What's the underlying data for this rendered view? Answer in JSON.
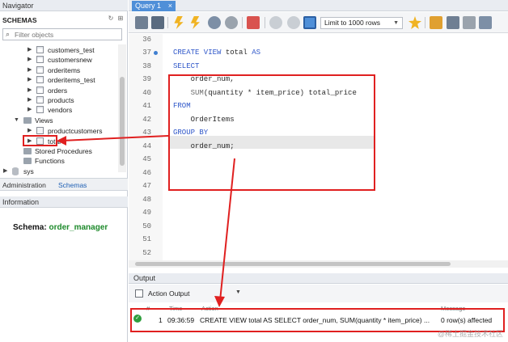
{
  "navigator": {
    "title": "Navigator",
    "schemas_title": "SCHEMAS",
    "filter_placeholder": "Filter objects",
    "tables": [
      "customers_test",
      "customersnew",
      "orderitems",
      "orderitems_test",
      "orders",
      "products",
      "vendors"
    ],
    "views_label": "Views",
    "views": [
      "productcustomers",
      "total"
    ],
    "stored_procedures_label": "Stored Procedures",
    "functions_label": "Functions",
    "sys_label": "sys",
    "tabs": [
      "Administration",
      "Schemas"
    ],
    "active_tab": "Schemas"
  },
  "information": {
    "title": "Information",
    "schema_label": "Schema:",
    "schema_value": "order_manager"
  },
  "editor": {
    "tab_title": "Query 1",
    "limit_label": "Limit to 1000 rows",
    "line_numbers": [
      "36",
      "37",
      "38",
      "39",
      "40",
      "41",
      "42",
      "43",
      "44",
      "45",
      "46",
      "47",
      "48",
      "49",
      "50",
      "51",
      "52"
    ],
    "sql": {
      "l37_kw": "CREATE VIEW",
      "l37_rest": " total ",
      "l37_kw2": "AS",
      "l38": "SELECT",
      "l39": "    order_num,",
      "l40_fn": "    SUM",
      "l40_rest": "(quantity * item_price) total_price",
      "l41": "FROM",
      "l42": "    OrderItems",
      "l43": "GROUP BY",
      "l44": "    order_num;"
    }
  },
  "output": {
    "title": "Output",
    "mode": "Action Output",
    "columns": [
      "#",
      "Time",
      "Action",
      "Message"
    ],
    "row": {
      "index": "1",
      "time": "09:36:59",
      "action": "CREATE VIEW total AS SELECT  order_num,     SUM(quantity * item_price) ...",
      "message": "0 row(s) affected"
    }
  },
  "watermark": "@稀土掘金技术社区",
  "colors": {
    "accent": "#4f8fd8",
    "keyword": "#2f57c9",
    "annotation": "#e02020",
    "schema_value": "#1d8a2b"
  }
}
